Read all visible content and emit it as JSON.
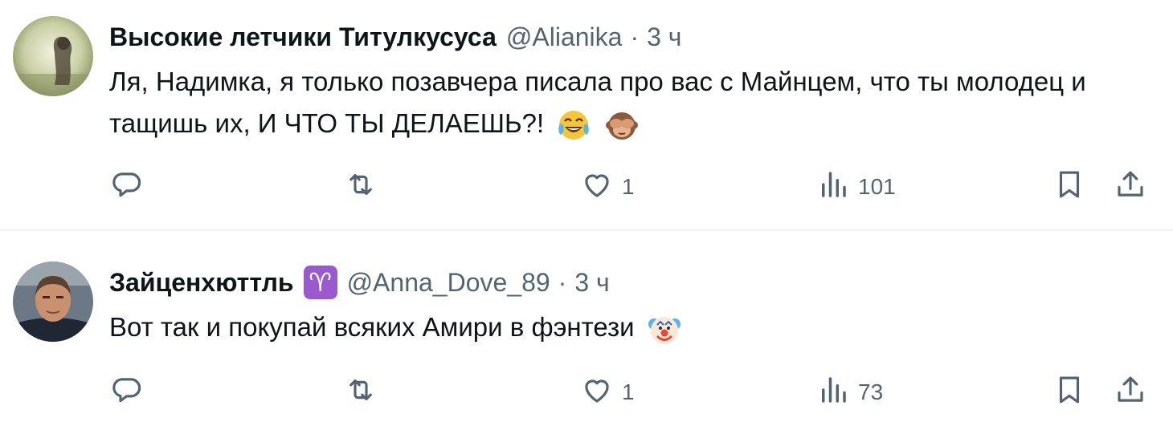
{
  "tweets": [
    {
      "author_name": "Высокие летчики Титулкусуса",
      "handle": "@Alianika",
      "separator": "·",
      "time": "3 ч",
      "text": "Ля, Надимка, я только позавчера писала про вас с Майнцем, что ты молодец и тащишь их, И ЧТО ТЫ ДЕЛАЕШЬ?!",
      "emojis": [
        "face-with-tears-of-joy",
        "see-no-evil-monkey"
      ],
      "actions": {
        "reply_count": "",
        "repost_count": "",
        "like_count": "1",
        "views_count": "101"
      }
    },
    {
      "author_name": "Зайценхюттль",
      "badge": "♈",
      "handle": "@Anna_Dove_89",
      "separator": "·",
      "time": "3 ч",
      "text": "Вот так и покупай всяких Амири в фэнтези",
      "emojis": [
        "clown-face"
      ],
      "actions": {
        "reply_count": "",
        "repost_count": "",
        "like_count": "1",
        "views_count": "73"
      }
    }
  ],
  "icons": [
    "reply-icon",
    "repost-icon",
    "like-icon",
    "views-icon",
    "bookmark-icon",
    "share-icon"
  ],
  "colors": {
    "text": "#0f1419",
    "secondary": "#536471",
    "divider": "#eff3f4",
    "badge": "#9b59d0"
  }
}
